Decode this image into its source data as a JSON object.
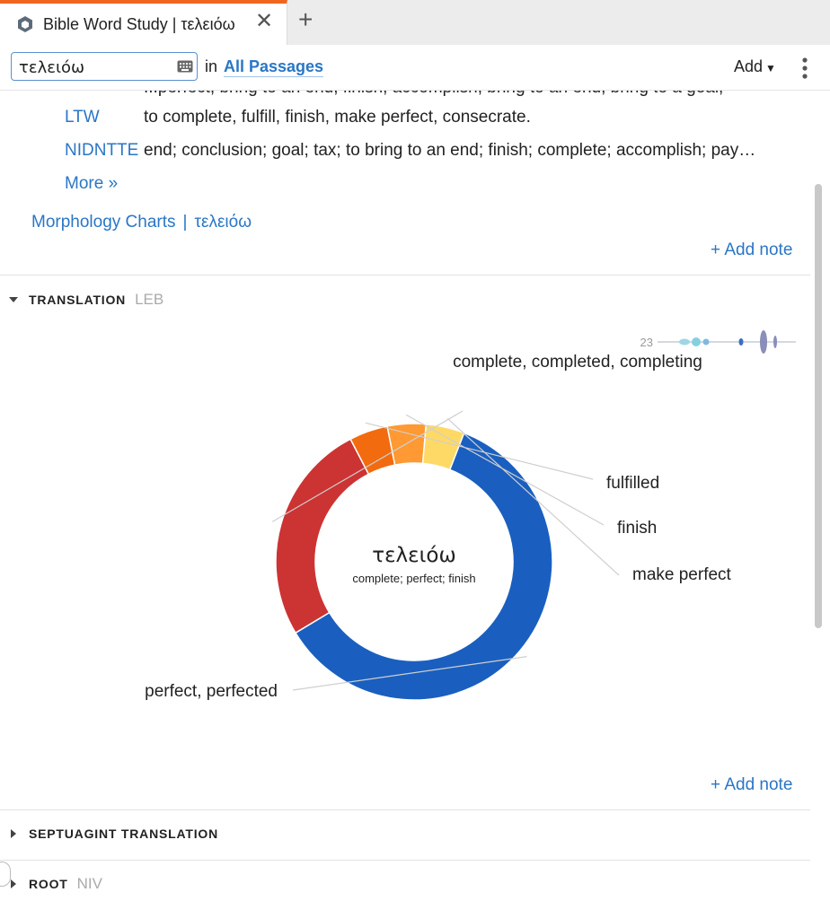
{
  "tab": {
    "title": "Bible Word Study | τελειόω",
    "close_glyph": "✕",
    "new_glyph": "+"
  },
  "toolbar": {
    "search_value": "τελειόω",
    "in_label": "in",
    "passages_label": "All Passages",
    "add_label": "Add",
    "add_caret": "▼"
  },
  "lexicon": {
    "cut_text": "...perfect, bring to an end, finish, accomplish, bring to an end, bring to a goal,",
    "entries": [
      {
        "abbr": "LTW",
        "definition": "to complete, fulfill, finish, make perfect, consecrate."
      },
      {
        "abbr": "NIDNTTE",
        "definition": "end; conclusion; goal; tax; to bring to an end; finish; complete; accomplish; pay…"
      }
    ],
    "more_label": "More »",
    "morph_label": "Morphology Charts",
    "morph_sep": "|",
    "morph_word": "τελειόω",
    "add_note_label": "+ Add note"
  },
  "translation_section": {
    "title": "TRANSLATION",
    "version": "LEB",
    "add_note_label": "+ Add note"
  },
  "septuagint_section": {
    "title": "SEPTUAGINT TRANSLATION"
  },
  "root_section": {
    "title": "ROOT",
    "version": "NIV"
  },
  "sparkline": {
    "count_label": "23"
  },
  "chart_data": {
    "type": "pie",
    "donut": true,
    "center_title": "τελειόω",
    "center_subtitle": "complete; perfect; finish",
    "slices": [
      {
        "label": "complete, completed, completing",
        "value": 26,
        "color": "#cc3333"
      },
      {
        "label": "fulfilled",
        "value": 4.5,
        "color": "#f26b0f"
      },
      {
        "label": "finish",
        "value": 4.5,
        "color": "#ff9933"
      },
      {
        "label": "make perfect",
        "value": 4.5,
        "color": "#ffd966"
      },
      {
        "label": "perfect, perfected",
        "value": 60.5,
        "color": "#1a5fbf"
      }
    ]
  }
}
